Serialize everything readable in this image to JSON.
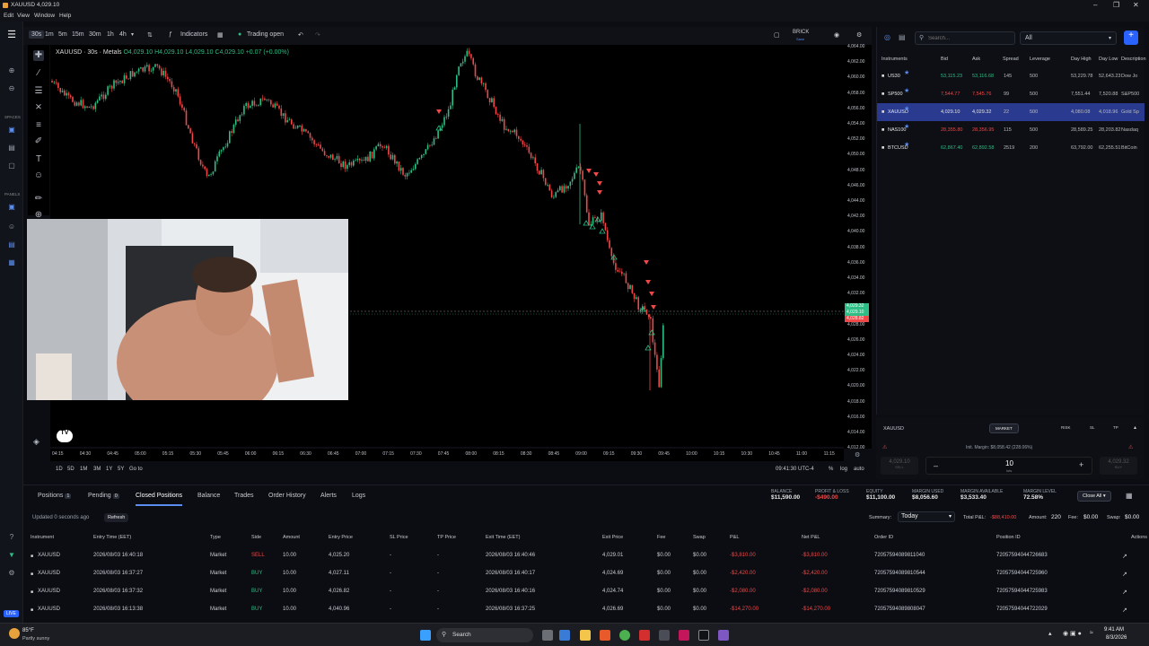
{
  "window": {
    "title": "XAUUSD 4,029.10"
  },
  "menu": [
    "Edit",
    "View",
    "Window",
    "Help"
  ],
  "toolbar": {
    "intervals": [
      "30s",
      "1m",
      "5m",
      "15m",
      "30m",
      "1h",
      "4h"
    ],
    "selected_interval": "30s",
    "indicators_label": "Indicators",
    "trading_status": "Trading open",
    "brick_label": "BRICK",
    "brick_sub": "Save"
  },
  "left_sections": {
    "spaces": "SPACES",
    "panels": "PANELS",
    "live": "LIVE"
  },
  "legend": {
    "symbol": "XAUUSD · 30s · Metals",
    "ohlc": "O4,029.10 H4,029.10 L4,029.10 C4,029.10 +0.07 (+0.00%)"
  },
  "price_ticks": [
    "4,064.00",
    "4,062.00",
    "4,060.00",
    "4,058.00",
    "4,056.00",
    "4,054.00",
    "4,052.00",
    "4,050.00",
    "4,048.00",
    "4,046.00",
    "4,044.00",
    "4,042.00",
    "4,040.00",
    "4,038.00",
    "4,036.00",
    "4,034.00",
    "4,032.00",
    "4,030.00",
    "4,028.00",
    "4,026.00",
    "4,024.00",
    "4,022.00",
    "4,020.00",
    "4,018.00",
    "4,016.00",
    "4,014.00",
    "4,012.00"
  ],
  "price_labels": {
    "ask": "4,029.32",
    "last": "4,029.10",
    "bid": "4,028.82"
  },
  "time_ticks": [
    "04:15",
    "04:30",
    "04:45",
    "05:00",
    "05:15",
    "05:30",
    "05:45",
    "06:00",
    "06:15",
    "06:30",
    "06:45",
    "07:00",
    "07:15",
    "07:30",
    "07:45",
    "08:00",
    "08:15",
    "08:30",
    "08:45",
    "09:00",
    "09:15",
    "09:30",
    "09:45",
    "10:00",
    "10:15",
    "10:30",
    "10:45",
    "11:00",
    "11:15"
  ],
  "rangebar": {
    "ranges": [
      "1D",
      "5D",
      "1M",
      "3M",
      "1Y",
      "5Y"
    ],
    "goto": "Go to",
    "clock": "09:41:30 UTC-4",
    "pct": "%",
    "log": "log",
    "auto": "auto"
  },
  "instruments": {
    "search_placeholder": "Search...",
    "filter": "All",
    "headers": [
      "Instruments",
      "Bid",
      "Ask",
      "Spread",
      "Leverage",
      "Day High",
      "Day Low",
      "Description"
    ],
    "rows": [
      {
        "name": "US30",
        "bid": "53,115.23",
        "ask": "53,116.68",
        "spread": "145",
        "lev": "500",
        "high": "53,229.78",
        "low": "52,643.23",
        "desc": "Dow Jo",
        "dir": "up"
      },
      {
        "name": "SP500",
        "bid": "7,544.77",
        "ask": "7,545.76",
        "spread": "99",
        "lev": "500",
        "high": "7,551.44",
        "low": "7,520.88",
        "desc": "S&P500",
        "dir": "down"
      },
      {
        "name": "XAUUSD",
        "bid": "4,029.10",
        "ask": "4,029.32",
        "spread": "22",
        "lev": "500",
        "high": "4,080.08",
        "low": "4,018.96",
        "desc": "Gold Sp",
        "dir": "sel"
      },
      {
        "name": "NAS100",
        "bid": "28,355.80",
        "ask": "28,356.95",
        "spread": "115",
        "lev": "500",
        "high": "28,589.25",
        "low": "28,203.82",
        "desc": "Nasdaq",
        "dir": "down"
      },
      {
        "name": "BTCUSD",
        "bid": "62,867.40",
        "ask": "62,892.58",
        "spread": "2519",
        "lev": "200",
        "high": "63,792.00",
        "low": "62,255.51",
        "desc": "BitCoin",
        "dir": "up"
      }
    ]
  },
  "order_panel": {
    "symbol": "XAUUSD",
    "type": "MARKET",
    "tabs": [
      "RISK",
      "SL",
      "TP"
    ],
    "margin": "Init. Margin: $8,058.42 (228.06%)",
    "sell_price": "4,029.10",
    "sell_label": "SELL",
    "qty": "10",
    "qty_unit": "lots",
    "buy_price": "4,029.32",
    "buy_label": "BUY"
  },
  "bottom": {
    "tabs": [
      {
        "label": "Positions",
        "badge": "1"
      },
      {
        "label": "Pending",
        "badge": "0"
      },
      {
        "label": "Closed Positions",
        "badge": ""
      },
      {
        "label": "Balance",
        "badge": ""
      },
      {
        "label": "Trades",
        "badge": ""
      },
      {
        "label": "Order History",
        "badge": ""
      },
      {
        "label": "Alerts",
        "badge": ""
      },
      {
        "label": "Logs",
        "badge": ""
      }
    ],
    "account": [
      {
        "label": "BALANCE",
        "value": "$11,590.00",
        "color": "#e6e6e6"
      },
      {
        "label": "PROFIT & LOSS",
        "value": "-$490.00",
        "color": "#f04848"
      },
      {
        "label": "EQUITY",
        "value": "$11,100.00",
        "color": "#e6e6e6"
      },
      {
        "label": "MARGIN USED",
        "value": "$8,056.60",
        "color": "#e6e6e6"
      },
      {
        "label": "MARGIN AVAILABLE",
        "value": "$3,533.40",
        "color": "#e6e6e6"
      },
      {
        "label": "MARGIN LEVEL",
        "value": "72.58%",
        "color": "#e6e6e6"
      }
    ],
    "close_all": "Close All",
    "updated": "Updated 0 seconds ago",
    "refresh": "Refresh",
    "summary_label": "Summary:",
    "summary_value": "Today",
    "total_pl_label": "Total P&L:",
    "total_pl": "-$88,410.00",
    "amount_label": "Amount:",
    "amount": "220",
    "fee_label": "Fee:",
    "fee": "$0.00",
    "swap_label": "Swap:",
    "swap": "$0.00",
    "headers": [
      "Instrument",
      "Entry Time (EET)",
      "Type",
      "Side",
      "Amount",
      "Entry Price",
      "SL Price",
      "TP Price",
      "Exit Time (EET)",
      "Exit Price",
      "Fee",
      "Swap",
      "P&L",
      "Net P&L",
      "Order ID",
      "Position ID",
      "Actions"
    ],
    "rows": [
      {
        "inst": "XAUUSD",
        "entry_time": "2026/08/03 16:40:18",
        "type": "Market",
        "side": "SELL",
        "amount": "10.00",
        "entry": "4,025.20",
        "sl": "-",
        "tp": "-",
        "exit_time": "2026/08/03 16:40:46",
        "exit": "4,029.01",
        "fee": "$0.00",
        "swap": "$0.00",
        "pl": "-$3,810.00",
        "net": "-$3,810.00",
        "order": "72057594089811040",
        "pos": "72057594044726683"
      },
      {
        "inst": "XAUUSD",
        "entry_time": "2026/08/03 16:37:27",
        "type": "Market",
        "side": "BUY",
        "amount": "10.00",
        "entry": "4,027.11",
        "sl": "-",
        "tp": "-",
        "exit_time": "2026/08/03 16:40:17",
        "exit": "4,024.69",
        "fee": "$0.00",
        "swap": "$0.00",
        "pl": "-$2,420.00",
        "net": "-$2,420.00",
        "order": "72057594089810544",
        "pos": "72057594044725960"
      },
      {
        "inst": "XAUUSD",
        "entry_time": "2026/08/03 16:37:32",
        "type": "Market",
        "side": "BUY",
        "amount": "10.00",
        "entry": "4,026.82",
        "sl": "-",
        "tp": "-",
        "exit_time": "2026/08/03 16:40:16",
        "exit": "4,024.74",
        "fee": "$0.00",
        "swap": "$0.00",
        "pl": "-$2,080.00",
        "net": "-$2,080.00",
        "order": "72057594089810529",
        "pos": "72057594044725983"
      },
      {
        "inst": "XAUUSD",
        "entry_time": "2026/08/03 16:13:38",
        "type": "Market",
        "side": "BUY",
        "amount": "10.00",
        "entry": "4,040.96",
        "sl": "-",
        "tp": "-",
        "exit_time": "2026/08/03 16:37:25",
        "exit": "4,026.69",
        "fee": "$0.00",
        "swap": "$0.00",
        "pl": "-$14,270.00",
        "net": "-$14,270.00",
        "order": "72057594089808047",
        "pos": "72057594044722029"
      }
    ]
  },
  "taskbar": {
    "weather_temp": "85°F",
    "weather_desc": "Partly sunny",
    "search": "Search",
    "time": "9:41 AM",
    "date": "8/3/2026"
  },
  "colors": {
    "up": "#2ebd85",
    "down": "#f04848",
    "accent": "#5b8def",
    "selected_row": "#2a3b8f"
  }
}
